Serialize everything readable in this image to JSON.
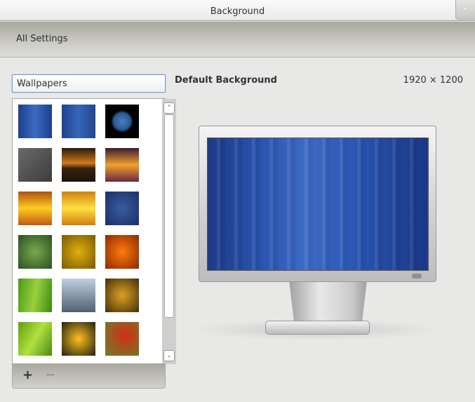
{
  "window": {
    "title": "Background",
    "close_icon": "close-icon"
  },
  "toolbar": {
    "all_settings": "All Settings"
  },
  "source_combo": {
    "value": "Wallpapers"
  },
  "preview": {
    "name": "Default Background",
    "resolution": "1920 × 1200"
  },
  "list_toolbar": {
    "add": "+",
    "remove": "−"
  },
  "thumbnails": [
    {
      "bg": "linear-gradient(90deg,#1d3f8c,#3a6bc2,#1d3f8c)"
    },
    {
      "bg": "linear-gradient(90deg,#1f438f,#3566b8,#21468f)"
    },
    {
      "bg": "radial-gradient(circle at 50% 50%,#4b7fc0 0,#2a5a95 35%,#000 47%)"
    },
    {
      "bg": "linear-gradient(135deg,#6a6a6a,#3c3c3c)"
    },
    {
      "bg": "linear-gradient(#2a1a0a,#d27a1c 45%,#3a2410 60%,#1a120a)"
    },
    {
      "bg": "linear-gradient(#3a1c30,#f0a030 50%,#6a2a40)"
    },
    {
      "bg": "linear-gradient(#b05010,#ffcc22 50%,#c05a10)"
    },
    {
      "bg": "linear-gradient(#d08010,#ffe040 50%,#d08010)"
    },
    {
      "bg": "radial-gradient(#3a5aa0,#1c2f6a)"
    },
    {
      "bg": "radial-gradient(#7aa850,#2a5020)"
    },
    {
      "bg": "radial-gradient(#e0b010,#7a5a00)"
    },
    {
      "bg": "radial-gradient(#ff7a10,#8a2a00)"
    },
    {
      "bg": "linear-gradient(100deg,#4a9a10,#9ad040,#3a8a10)"
    },
    {
      "bg": "linear-gradient(#c0d0e0,#506070)"
    },
    {
      "bg": "radial-gradient(#e0a020,#403010)"
    },
    {
      "bg": "linear-gradient(120deg,#60a010,#b0e040,#4a8a10)"
    },
    {
      "bg": "radial-gradient(#ffc020,#202010)"
    },
    {
      "bg": "radial-gradient(circle at 60% 40%,#d03010,#6a8030)"
    }
  ]
}
